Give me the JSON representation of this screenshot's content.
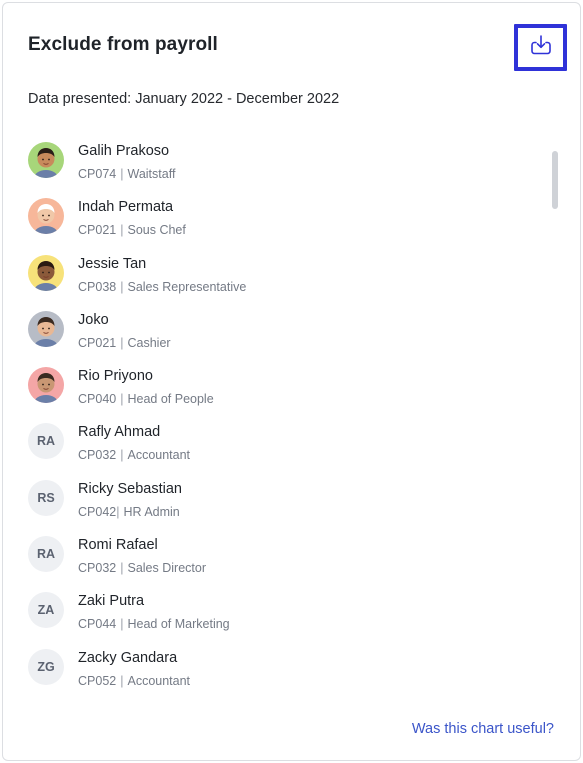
{
  "header": {
    "title": "Exclude from payroll",
    "download_icon": "download-icon",
    "accent_color": "#2f32d8"
  },
  "subtitle": "Data presented: January 2022 - December 2022",
  "employees": [
    {
      "name": "Galih Prakoso",
      "code": "CP074",
      "role": "Waitstaff",
      "avatar": "memoji",
      "avatar_color": "#a7d67a",
      "skin": "#c88a5c",
      "hair": "#2a1e17"
    },
    {
      "name": "Indah Permata",
      "code": "CP021",
      "role": "Sous Chef",
      "avatar": "memoji",
      "avatar_color": "#f7b79a",
      "skin": "#f0c8a8",
      "hair": "#ffffff"
    },
    {
      "name": "Jessie Tan",
      "code": "CP038",
      "role": "Sales Representative",
      "avatar": "memoji",
      "avatar_color": "#f7e27a",
      "skin": "#8b5a3a",
      "hair": "#2a1a12"
    },
    {
      "name": "Joko",
      "code": "CP021",
      "role": "Cashier",
      "avatar": "memoji",
      "avatar_color": "#b7bcc6",
      "skin": "#e8b895",
      "hair": "#3a2a20"
    },
    {
      "name": "Rio Priyono",
      "code": "CP040",
      "role": "Head of People",
      "avatar": "memoji",
      "avatar_color": "#f4a6a6",
      "skin": "#c99773",
      "hair": "#3a2a20"
    },
    {
      "name": "Rafly Ahmad",
      "code": "CP032",
      "role": "Accountant",
      "avatar": "initials",
      "initials": "RA"
    },
    {
      "name": "Ricky Sebastian",
      "code": "CP042",
      "role": "HR Admin",
      "avatar": "initials",
      "initials": "RS",
      "tight": true
    },
    {
      "name": "Romi Rafael",
      "code": "CP032",
      "role": "Sales Director",
      "avatar": "initials",
      "initials": "RA"
    },
    {
      "name": "Zaki Putra",
      "code": "CP044",
      "role": "Head of Marketing",
      "avatar": "initials",
      "initials": "ZA"
    },
    {
      "name": "Zacky Gandara",
      "code": "CP052",
      "role": "Accountant",
      "avatar": "initials",
      "initials": "ZG"
    }
  ],
  "footer": {
    "link_label": "Was this chart useful?"
  }
}
